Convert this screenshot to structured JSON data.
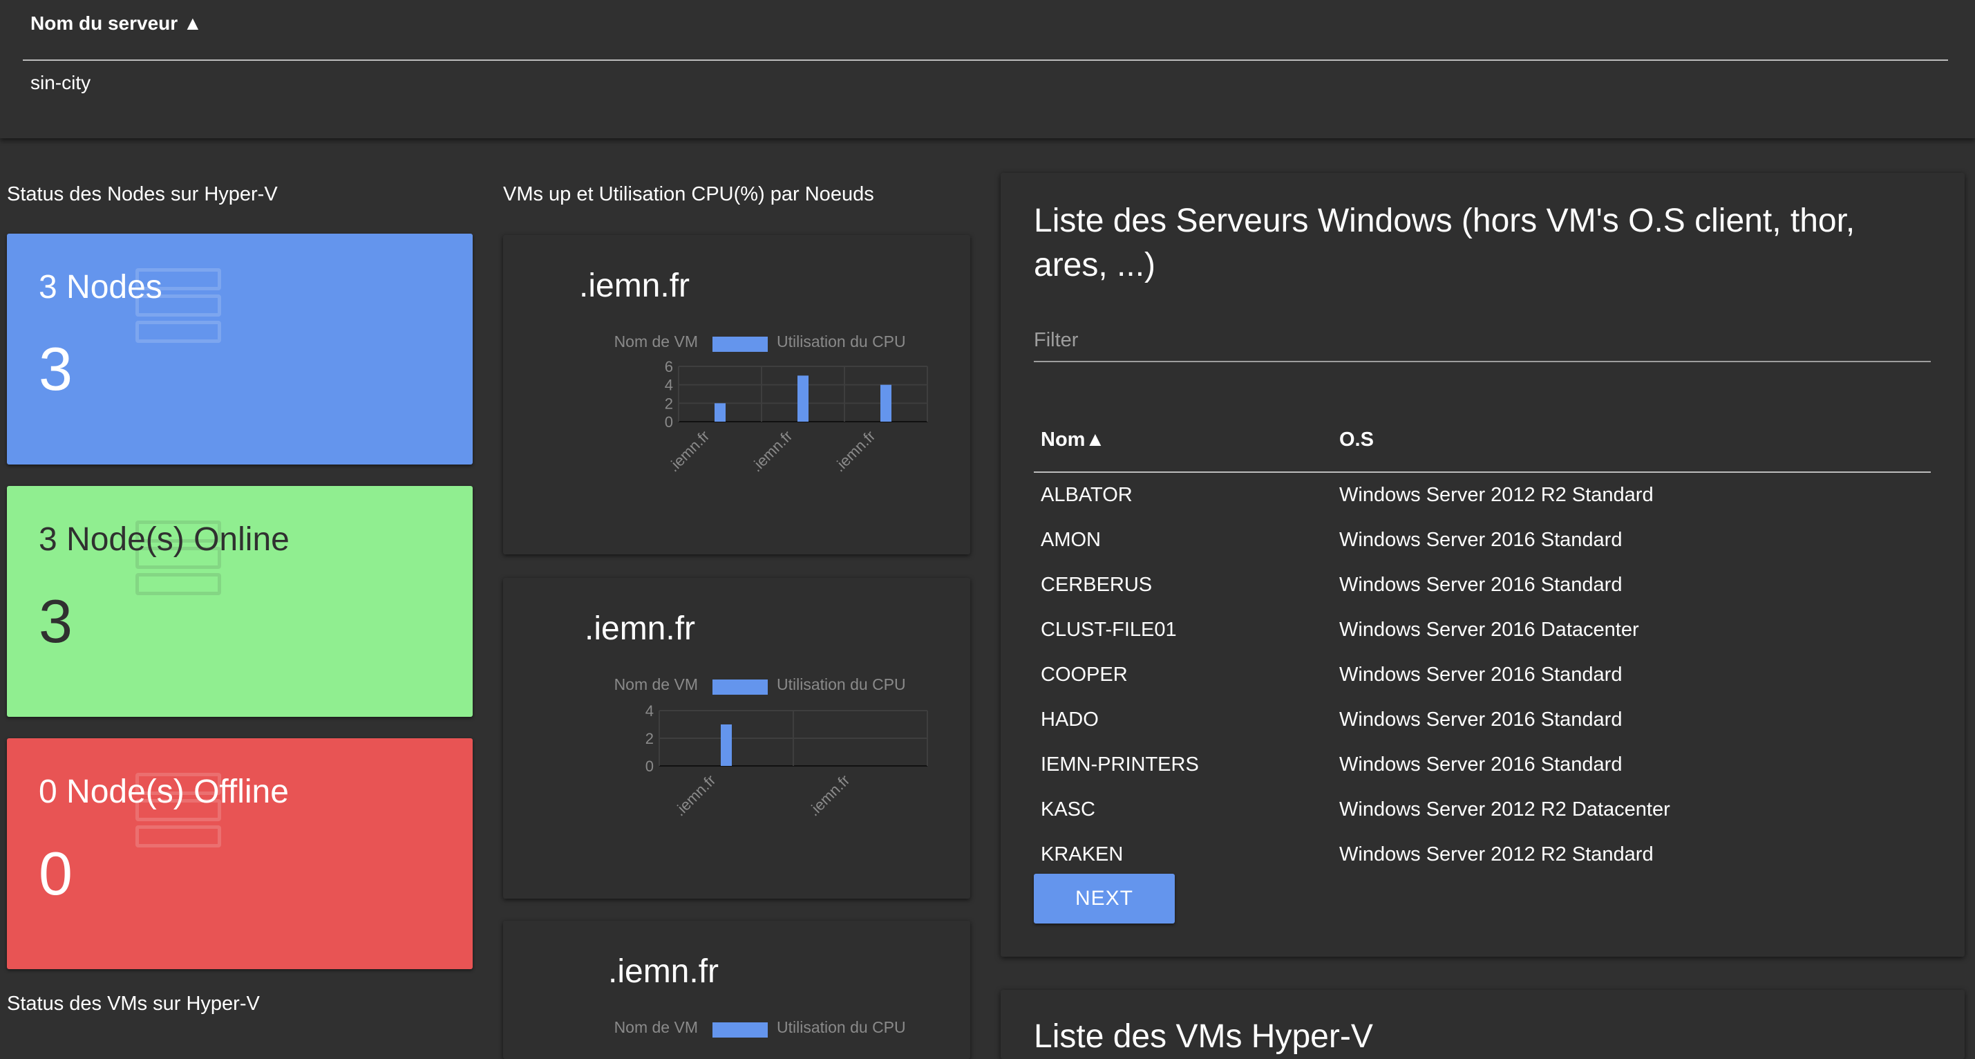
{
  "header": {
    "column": "Nom du serveur",
    "sort_icon": "▲",
    "value": "sin-city"
  },
  "sections": {
    "nodes_status": "Status des Nodes sur Hyper-V",
    "vms_cpu": "VMs up et Utilisation CPU(%) par Noeuds",
    "vms_status": "Status des VMs sur Hyper-V"
  },
  "cards": [
    {
      "label": "3 Nodes",
      "count": "3",
      "color": "#6495ed",
      "icon": "server-icon"
    },
    {
      "label": "3 Node(s) Online",
      "count": "3",
      "color": "#90ee90",
      "icon": "server-icon"
    },
    {
      "label": "0 Node(s) Offline",
      "count": "0",
      "color": "#e85454",
      "icon": "server-icon"
    }
  ],
  "chart_data": [
    {
      "type": "bar",
      "title": ".iemn.fr",
      "legend": [
        "Nom de VM",
        "Utilisation du CPU"
      ],
      "categories": [
        ".iemn.fr",
        ".iemn.fr",
        ".iemn.fr"
      ],
      "values": [
        2,
        5,
        4
      ],
      "yticks": [
        "0",
        "2",
        "4",
        "6"
      ],
      "ylim": [
        0,
        6
      ],
      "grid": true,
      "color": "#6495ed"
    },
    {
      "type": "bar",
      "title": ".iemn.fr",
      "legend": [
        "Nom de VM",
        "Utilisation du CPU"
      ],
      "categories": [
        ".iemn.fr",
        ".iemn.fr"
      ],
      "values": [
        3,
        0
      ],
      "yticks": [
        "0",
        "2",
        "4"
      ],
      "ylim": [
        0,
        4
      ],
      "grid": true,
      "color": "#6495ed"
    },
    {
      "type": "bar",
      "title": ".iemn.fr",
      "legend": [
        "Nom de VM",
        "Utilisation du CPU"
      ],
      "categories": [],
      "values": [],
      "color": "#6495ed"
    }
  ],
  "servers_panel": {
    "title": "Liste des Serveurs Windows (hors VM's O.S client, thor, ares, ...)",
    "filter_placeholder": "Filter",
    "columns": [
      "Nom",
      "O.S"
    ],
    "sort_icon": "▲",
    "rows": [
      [
        "ALBATOR",
        "Windows Server 2012 R2 Standard"
      ],
      [
        "AMON",
        "Windows Server 2016 Standard"
      ],
      [
        "CERBERUS",
        "Windows Server 2016 Standard"
      ],
      [
        "CLUST-FILE01",
        "Windows Server 2016 Datacenter"
      ],
      [
        "COOPER",
        "Windows Server 2016 Standard"
      ],
      [
        "HADO",
        "Windows Server 2016 Standard"
      ],
      [
        "IEMN-PRINTERS",
        "Windows Server 2016 Standard"
      ],
      [
        "KASC",
        "Windows Server 2012 R2 Datacenter"
      ],
      [
        "KRAKEN",
        "Windows Server 2012 R2 Standard"
      ]
    ],
    "next_label": "NEXT"
  },
  "vms_panel": {
    "title": "Liste des VMs Hyper-V"
  }
}
